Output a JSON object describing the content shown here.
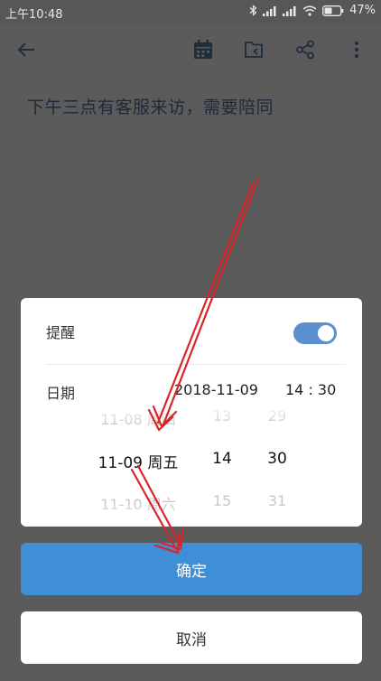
{
  "status_bar": {
    "time": "上午10:48",
    "battery_percent": "47%",
    "icons": [
      "bluetooth-icon",
      "signal-icon",
      "signal-icon",
      "wifi-icon",
      "battery-icon"
    ]
  },
  "toolbar": {
    "icons": [
      "back-arrow-icon",
      "calendar-icon",
      "folder-icon",
      "share-icon",
      "more-vertical-icon"
    ]
  },
  "note": {
    "text": "下午三点有客服来访，需要陪同"
  },
  "dialog": {
    "reminder_label": "提醒",
    "reminder_on": true,
    "date_label": "日期",
    "date_value": "2018-11-09",
    "time_value": "14 : 30",
    "picker": {
      "date": {
        "prev": "11-08 周四",
        "selected": "11-09 周五",
        "next": "11-10 周六"
      },
      "hour": {
        "prev": "13",
        "selected": "14",
        "next": "15"
      },
      "minute": {
        "prev": "29",
        "selected": "30",
        "next": "31"
      }
    }
  },
  "buttons": {
    "confirm": "确定",
    "cancel": "取消"
  },
  "colors": {
    "accent": "#3f8fd6",
    "toggle": "#5b8fcf",
    "annotation_arrow": "#d9252a",
    "overlay": "#5b5b5b"
  }
}
